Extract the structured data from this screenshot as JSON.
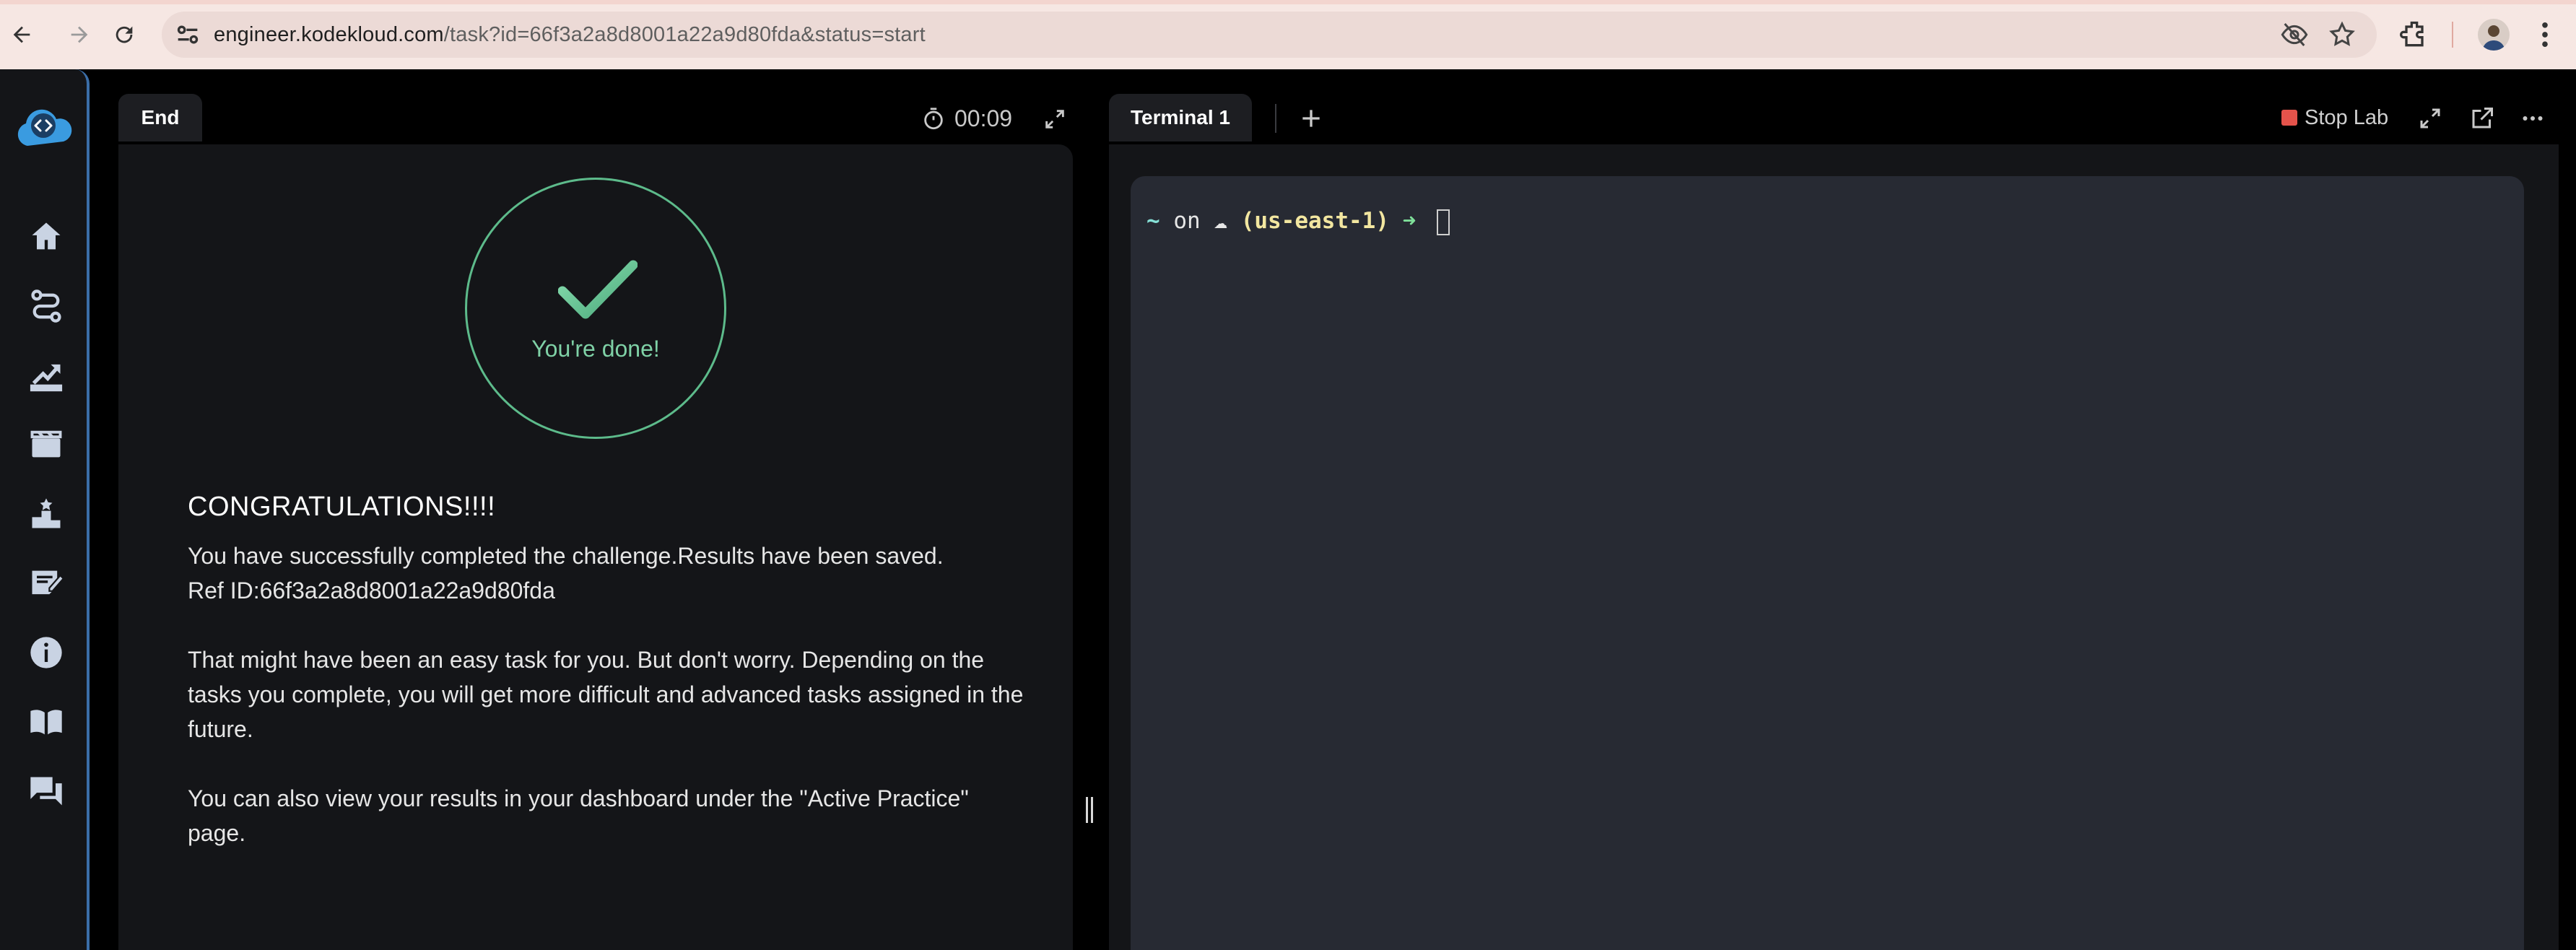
{
  "browser": {
    "url_host": "engineer.kodekloud.com",
    "url_path": "/task?id=66f3a2a8d8001a22a9d80fda&status=start"
  },
  "sidebar": {
    "items": [
      {
        "name": "home",
        "icon": "home-icon"
      },
      {
        "name": "roadmap",
        "icon": "route-icon"
      },
      {
        "name": "progress",
        "icon": "growth-icon"
      },
      {
        "name": "learning",
        "icon": "board-icon"
      },
      {
        "name": "leaderboard",
        "icon": "podium-icon"
      },
      {
        "name": "tasks",
        "icon": "notes-icon"
      },
      {
        "name": "info",
        "icon": "info-icon"
      },
      {
        "name": "docs",
        "icon": "book-icon"
      },
      {
        "name": "chat",
        "icon": "chat-icon"
      }
    ]
  },
  "left_panel": {
    "tab_label": "End",
    "timer": "00:09",
    "done_text": "You're done!",
    "heading": "CONGRATULATIONS!!!!",
    "paragraph1_line1": "You have successfully completed the challenge.Results have been saved.",
    "paragraph1_line2": "Ref ID:66f3a2a8d8001a22a9d80fda",
    "paragraph2": "That might have been an easy task for you. But don't worry. Depending on the tasks you complete, you will get more difficult and advanced tasks assigned in the future.",
    "paragraph3": "You can also view your results in your dashboard under the \"Active Practice\" page."
  },
  "right_panel": {
    "tab_label": "Terminal 1",
    "stop_label": "Stop Lab",
    "prompt": {
      "tilde": "~",
      "on": "on",
      "cloud": "☁",
      "region": "(us-east-1)",
      "arrow": "➜"
    }
  },
  "colors": {
    "accent_green": "#5dbb8b",
    "stop_red": "#e5534b",
    "sidebar_border": "#3b6ea8"
  }
}
